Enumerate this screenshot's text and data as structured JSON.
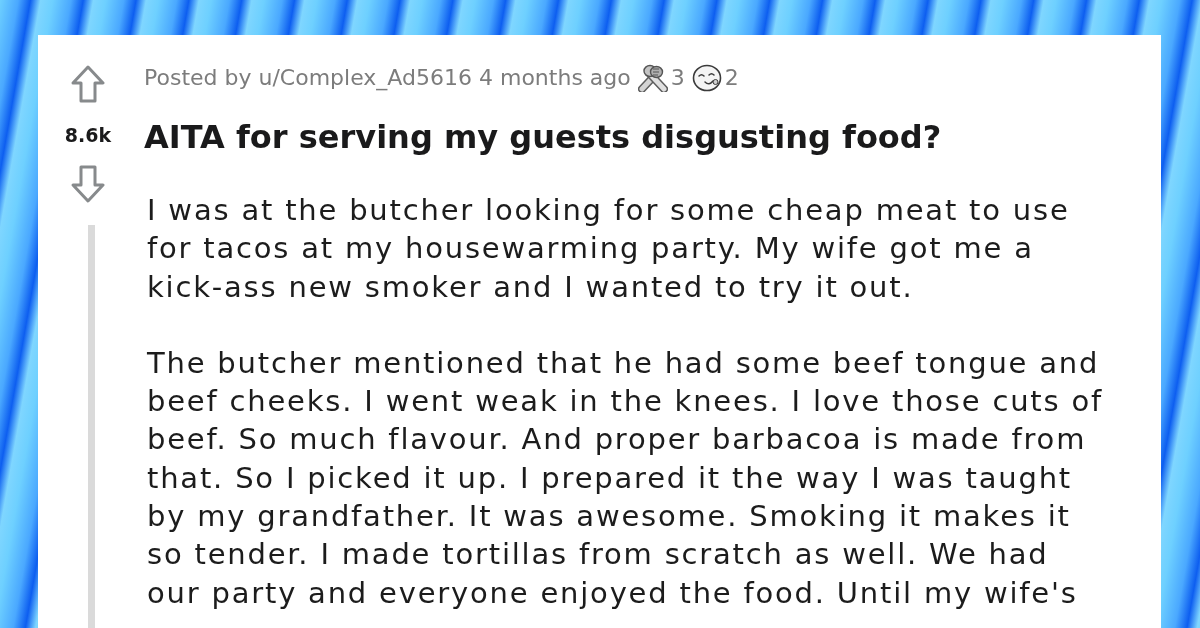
{
  "vote": {
    "score": "8.6k"
  },
  "post": {
    "meta": {
      "prefix": "Posted by",
      "author": "u/Complex_Ad5616",
      "time": "4 months ago"
    },
    "awards": [
      {
        "kind": "arms",
        "count": "3"
      },
      {
        "kind": "face",
        "count": "2"
      }
    ],
    "title": "AITA for serving my guests disgusting food?",
    "body": [
      {
        "lines": [
          "I was at the butcher looking for some cheap meat to use",
          "for tacos at my housewarming party. My wife got me a",
          "kick-ass new smoker and I wanted to try it out."
        ]
      },
      {
        "lines": [
          "The butcher mentioned that he had some beef tongue and",
          "beef cheeks. I went weak in the knees. I love those cuts of",
          "beef. So much flavour. And proper barbacoa is made from",
          "that. So I picked it up. I prepared it the way I was taught",
          "by my grandfather. It was awesome. Smoking it makes it",
          "so tender. I made tortillas from scratch as well. We had",
          "our party and everyone enjoyed the food. Until my wife's"
        ]
      }
    ]
  }
}
